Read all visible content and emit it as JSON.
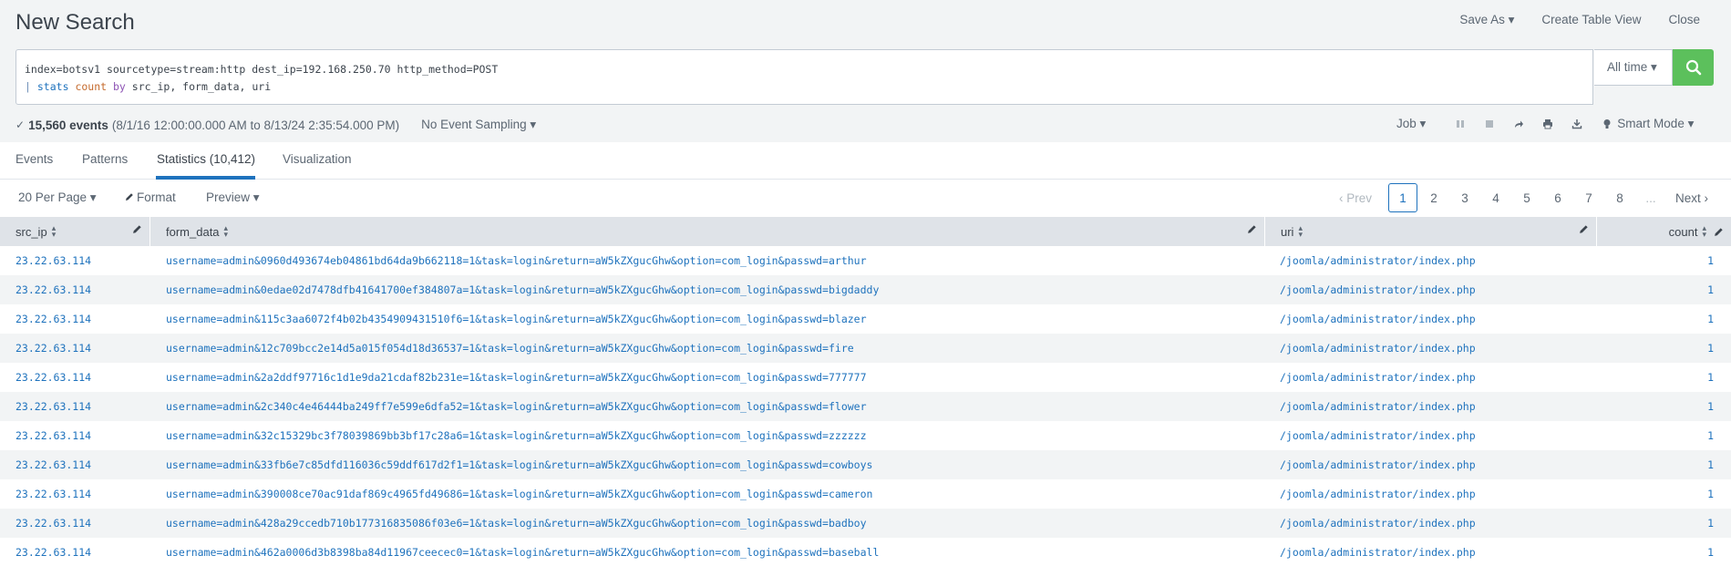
{
  "header": {
    "title": "New Search",
    "save_as": "Save As ▾",
    "create_table_view": "Create Table View",
    "close": "Close"
  },
  "search": {
    "line1": "index=botsv1 sourcetype=stream:http dest_ip=192.168.250.70 http_method=POST",
    "pipe": "|",
    "cmd": "stats",
    "fn": "count",
    "kw": "by",
    "fields": "src_ip, form_data, uri",
    "time_range": "All time ▾"
  },
  "status": {
    "event_count": "15,560 events",
    "range": "(8/1/16 12:00:00.000 AM to 8/13/24 2:35:54.000 PM)",
    "sampling": "No Event Sampling ▾",
    "job": "Job ▾",
    "mode": "Smart Mode ▾"
  },
  "tabs": [
    {
      "label": "Events"
    },
    {
      "label": "Patterns"
    },
    {
      "label": "Statistics (10,412)"
    },
    {
      "label": "Visualization"
    }
  ],
  "controls": {
    "per_page": "20 Per Page ▾",
    "format": "Format",
    "preview": "Preview ▾"
  },
  "pager": {
    "prev": "‹ Prev",
    "pages": [
      "1",
      "2",
      "3",
      "4",
      "5",
      "6",
      "7",
      "8"
    ],
    "ellipsis": "...",
    "next": "Next ›"
  },
  "table": {
    "columns": [
      "src_ip",
      "form_data",
      "uri",
      "count"
    ],
    "rows": [
      {
        "src_ip": "23.22.63.114",
        "form_data": "username=admin&0960d493674eb04861bd64da9b662118=1&task=login&return=aW5kZXgucGhw&option=com_login&passwd=arthur",
        "uri": "/joomla/administrator/index.php",
        "count": "1"
      },
      {
        "src_ip": "23.22.63.114",
        "form_data": "username=admin&0edae02d7478dfb41641700ef384807a=1&task=login&return=aW5kZXgucGhw&option=com_login&passwd=bigdaddy",
        "uri": "/joomla/administrator/index.php",
        "count": "1"
      },
      {
        "src_ip": "23.22.63.114",
        "form_data": "username=admin&115c3aa6072f4b02b4354909431510f6=1&task=login&return=aW5kZXgucGhw&option=com_login&passwd=blazer",
        "uri": "/joomla/administrator/index.php",
        "count": "1"
      },
      {
        "src_ip": "23.22.63.114",
        "form_data": "username=admin&12c709bcc2e14d5a015f054d18d36537=1&task=login&return=aW5kZXgucGhw&option=com_login&passwd=fire",
        "uri": "/joomla/administrator/index.php",
        "count": "1"
      },
      {
        "src_ip": "23.22.63.114",
        "form_data": "username=admin&2a2ddf97716c1d1e9da21cdaf82b231e=1&task=login&return=aW5kZXgucGhw&option=com_login&passwd=777777",
        "uri": "/joomla/administrator/index.php",
        "count": "1"
      },
      {
        "src_ip": "23.22.63.114",
        "form_data": "username=admin&2c340c4e46444ba249ff7e599e6dfa52=1&task=login&return=aW5kZXgucGhw&option=com_login&passwd=flower",
        "uri": "/joomla/administrator/index.php",
        "count": "1"
      },
      {
        "src_ip": "23.22.63.114",
        "form_data": "username=admin&32c15329bc3f78039869bb3bf17c28a6=1&task=login&return=aW5kZXgucGhw&option=com_login&passwd=zzzzzz",
        "uri": "/joomla/administrator/index.php",
        "count": "1"
      },
      {
        "src_ip": "23.22.63.114",
        "form_data": "username=admin&33fb6e7c85dfd116036c59ddf617d2f1=1&task=login&return=aW5kZXgucGhw&option=com_login&passwd=cowboys",
        "uri": "/joomla/administrator/index.php",
        "count": "1"
      },
      {
        "src_ip": "23.22.63.114",
        "form_data": "username=admin&390008ce70ac91daf869c4965fd49686=1&task=login&return=aW5kZXgucGhw&option=com_login&passwd=cameron",
        "uri": "/joomla/administrator/index.php",
        "count": "1"
      },
      {
        "src_ip": "23.22.63.114",
        "form_data": "username=admin&428a29ccedb710b177316835086f03e6=1&task=login&return=aW5kZXgucGhw&option=com_login&passwd=badboy",
        "uri": "/joomla/administrator/index.php",
        "count": "1"
      },
      {
        "src_ip": "23.22.63.114",
        "form_data": "username=admin&462a0006d3b8398ba84d11967ceecec0=1&task=login&return=aW5kZXgucGhw&option=com_login&passwd=baseball",
        "uri": "/joomla/administrator/index.php",
        "count": "1"
      }
    ]
  },
  "colors": {
    "accent": "#1e72bd",
    "search_button": "#5cc05c",
    "header_bg": "#f2f4f5"
  },
  "icons": [
    "search-icon",
    "check-icon",
    "pause-icon",
    "stop-icon",
    "share-icon",
    "print-icon",
    "export-icon",
    "bulb-icon",
    "pencil-icon",
    "sort-icon"
  ]
}
